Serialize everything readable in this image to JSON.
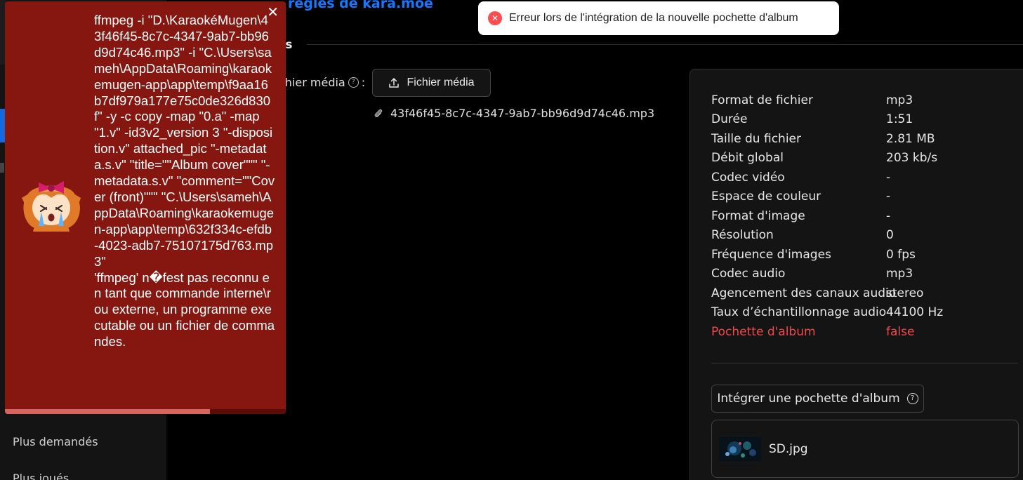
{
  "header": {
    "rules_link": "règles de kara.moe",
    "section_fragment": "rs"
  },
  "sidebar": {
    "items": [
      {
        "label": "Plus demandés"
      },
      {
        "label": "Plus joués"
      }
    ]
  },
  "media": {
    "field_label": "chier média",
    "field_colon": ":",
    "button_label": "Fichier média",
    "file_name": "43f46f45-8c7c-4347-9ab7-bb96d9d74c46.mp3"
  },
  "info": {
    "rows": [
      {
        "key": "Format de fichier",
        "value": "mp3"
      },
      {
        "key": "Durée",
        "value": "1:51"
      },
      {
        "key": "Taille du fichier",
        "value": "2.81 MB"
      },
      {
        "key": "Débit global",
        "value": "203 kb/s"
      },
      {
        "key": "Codec vidéo",
        "value": "-"
      },
      {
        "key": "Espace de couleur",
        "value": "-"
      },
      {
        "key": "Format d'image",
        "value": "-"
      },
      {
        "key": "Résolution",
        "value": "0"
      },
      {
        "key": "Fréquence d'images",
        "value": "0 fps"
      },
      {
        "key": "Codec audio",
        "value": "mp3"
      },
      {
        "key": "Agencement des canaux audio",
        "value": "stereo"
      },
      {
        "key": "Taux d’échantillonnage audio",
        "value": "44100 Hz"
      },
      {
        "key": "Pochette d'album",
        "value": "false"
      }
    ],
    "embed_button": "Intégrer une pochette d'album",
    "cover_file": "SD.jpg"
  },
  "toast": {
    "message": "Erreur lors de l'intégration de la nouvelle pochette d'album"
  },
  "error": {
    "message": "ffmpeg -i \"D.\\KaraokéMugen\\43f46f45-8c7c-4347-9ab7-bb96d9d74c46.mp3\" -i \"C.\\Users\\sameh\\AppData\\Roaming\\karaokemugen-app\\app\\temp\\f9aa16b7df979a177e75c0de326d830f\" -y -c copy -map \"0.a\" -map \"1.v\" -id3v2_version 3 \"-disposition.v\" attached_pic \"-metadata.s.v\" \"title=\"\"Album cover\"\"\" \"-metadata.s.v\" \"comment=\"\"Cover (front)\"\"\" \"C.\\Users\\sameh\\AppData\\Roaming\\karaokemugen-app\\app\\temp\\632f334c-efdb-4023-adb7-75107175d763.mp3\"\n'ffmpeg' n�fest pas reconnu en tant que commande interne\\r ou externe, un programme executable ou un fichier de commandes.",
    "progress": 0.73
  },
  "colors": {
    "error_bg": "#861710",
    "accent": "#1677ff",
    "danger": "#f0484a"
  }
}
